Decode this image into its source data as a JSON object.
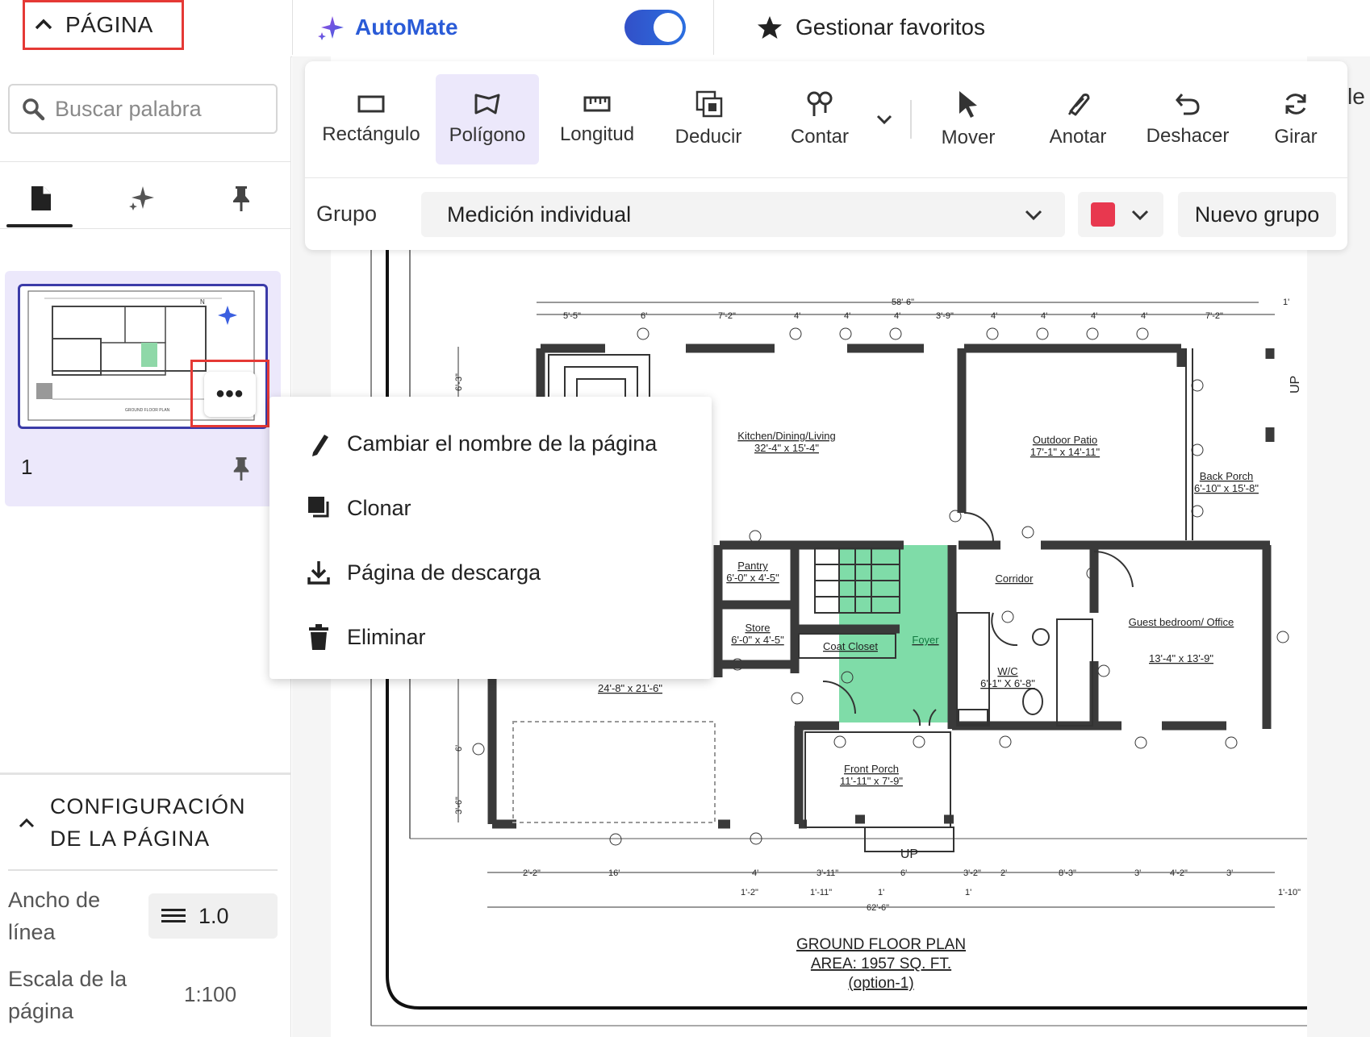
{
  "topbar": {
    "page_label": "PÁGINA",
    "automate_label": "AutoMate",
    "automate_enabled": true,
    "favorites_label": "Gestionar favoritos",
    "automate_color": "#2a5bd7"
  },
  "sidebar": {
    "search_placeholder": "Buscar palabra",
    "tabs": [
      "pages",
      "ai",
      "pinned"
    ],
    "page_number": "1",
    "config_title": "CONFIGURACIÓN DE LA PÁGINA",
    "line_width_label": "Ancho de línea",
    "line_width_value": "1.0",
    "scale_label": "Escala de la página",
    "scale_value": "1:100"
  },
  "toolbar": {
    "tools": [
      {
        "label": "Rectángulo",
        "icon": "rectangle-icon",
        "active": false
      },
      {
        "label": "Polígono",
        "icon": "polygon-icon",
        "active": true
      },
      {
        "label": "Longitud",
        "icon": "ruler-icon",
        "active": false
      },
      {
        "label": "Deducir",
        "icon": "deduct-icon",
        "active": false
      },
      {
        "label": "Contar",
        "icon": "count-icon",
        "active": false
      },
      {
        "label": "Mover",
        "icon": "cursor-icon",
        "active": false
      },
      {
        "label": "Anotar",
        "icon": "annotate-icon",
        "active": false
      },
      {
        "label": "Deshacer",
        "icon": "undo-icon",
        "active": false
      },
      {
        "label": "Girar",
        "icon": "rotate-icon",
        "active": false
      }
    ],
    "group_label": "Grupo",
    "group_value": "Medición individual",
    "color_value": "#e8384f",
    "new_group_label": "Nuevo grupo"
  },
  "context_menu": {
    "items": [
      {
        "label": "Cambiar el nombre de la página",
        "icon": "pencil-icon"
      },
      {
        "label": "Clonar",
        "icon": "clone-icon"
      },
      {
        "label": "Página de descarga",
        "icon": "download-icon"
      },
      {
        "label": "Eliminar",
        "icon": "trash-icon"
      }
    ]
  },
  "plan": {
    "overall_dim": "58'-6\"",
    "top_dims": [
      "5'-5\"",
      "6'",
      "7'-2\"",
      "4'",
      "4'",
      "4'",
      "3'-9\"",
      "4'",
      "4'",
      "4'",
      "4'",
      "7'-2\"",
      "1'"
    ],
    "left_dims": [
      "6'-3\"",
      "6'",
      "3'-6\""
    ],
    "bottom_dims": [
      "2'-2\"",
      "16'",
      "4'",
      "3'-11\"",
      "6'",
      "3'-2\"",
      "2'",
      "8'-3\"",
      "3'",
      "4'-2\"",
      "3'"
    ],
    "bottom_sub_dims": [
      "1'-2\"",
      "1'-11\"",
      "1'",
      "1'",
      "1'-10\""
    ],
    "bottom_total": "62'-6\"",
    "rooms": [
      {
        "name": "Kitchen/Dining/Living",
        "dim": "32'-4\" x 15'-4\""
      },
      {
        "name": "Outdoor Patio",
        "dim": "17'-1\" x 14'-11\""
      },
      {
        "name": "Back Porch",
        "dim": "6'-10\" x 15'-8\""
      },
      {
        "name": "Pantry",
        "dim": "6'-0\" x 4'-5\""
      },
      {
        "name": "Store",
        "dim": "6'-0\" x 4'-5\""
      },
      {
        "name": "Coat Closet",
        "dim": ""
      },
      {
        "name": "Foyer",
        "dim": ""
      },
      {
        "name": "Corridor",
        "dim": ""
      },
      {
        "name": "W/C",
        "dim": "6'-1\" X 6'-8\""
      },
      {
        "name": "Guest bedroom/ Office",
        "dim": "13'-4\" x 13'-9\""
      },
      {
        "name": "Front Porch",
        "dim": "11'-11\" x 7'-9\""
      },
      {
        "name": "",
        "dim": "24'-8\" x 21'-6\""
      }
    ],
    "up_label": "UP",
    "title_line1": "GROUND FLOOR PLAN",
    "title_line2": "AREA: 1957 SQ. FT.",
    "title_line3": "(option-1)",
    "foyer_color": "#7fdca8",
    "partial_label": "le"
  }
}
